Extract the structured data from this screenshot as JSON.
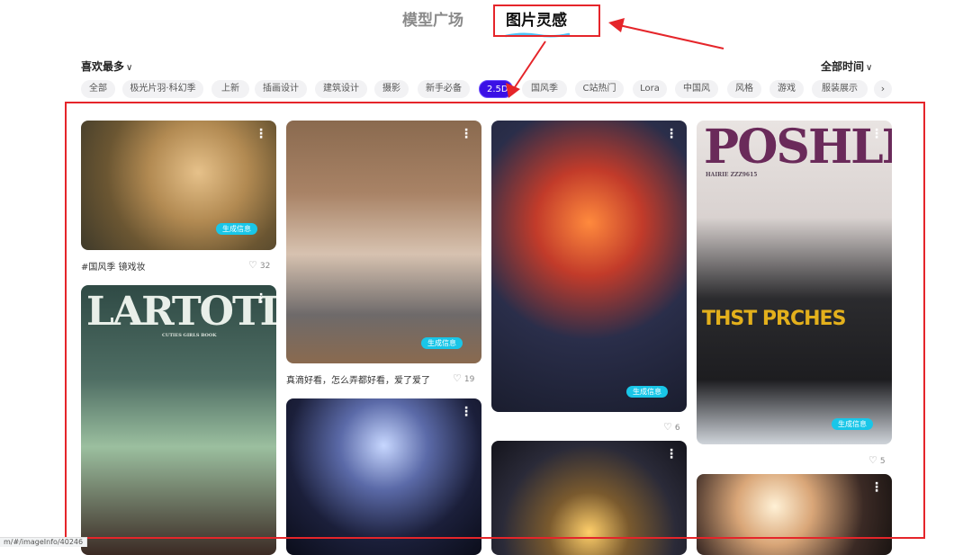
{
  "header": {
    "tabs": [
      {
        "label": "模型广场",
        "active": false
      },
      {
        "label": "图片灵感",
        "active": true
      }
    ]
  },
  "filters": {
    "sort_label": "喜欢最多",
    "time_label": "全部时间",
    "tags": [
      {
        "label": "全部",
        "active": false
      },
      {
        "label": "极光片羽·科幻季",
        "active": false
      },
      {
        "label": "上新",
        "active": false
      },
      {
        "label": "插画设计",
        "active": false
      },
      {
        "label": "建筑设计",
        "active": false
      },
      {
        "label": "摄影",
        "active": false
      },
      {
        "label": "新手必备",
        "active": false
      },
      {
        "label": "2.5D",
        "active": true
      },
      {
        "label": "国风季",
        "active": false
      },
      {
        "label": "C站热门",
        "active": false
      },
      {
        "label": "Lora",
        "active": false
      },
      {
        "label": "中国风",
        "active": false
      },
      {
        "label": "风格",
        "active": false
      },
      {
        "label": "游戏",
        "active": false
      },
      {
        "label": "服装展示",
        "active": false
      }
    ],
    "more_icon": "chevron-right-icon"
  },
  "cards": [
    {
      "badge": "生成信息",
      "caption": "#国风季 镜戏妆",
      "likes": "32"
    },
    {
      "badge": "",
      "caption": "",
      "likes": "",
      "magazine_title": "LARTOTIE",
      "magazine_sub": "CUTIES GIRLS BOOK"
    },
    {
      "badge": "生成信息",
      "caption": "真滴好看，怎么弄都好看，爱了爱了",
      "likes": "19"
    },
    {
      "badge": "",
      "caption": "",
      "likes": ""
    },
    {
      "badge": "生成信息",
      "caption": "",
      "likes": "6"
    },
    {
      "badge": "",
      "caption": "",
      "likes": ""
    },
    {
      "badge": "生成信息",
      "caption": "",
      "likes": "5",
      "magazine_title": "POSHLD",
      "magazine_sub": "HAIRIE ZZZ9615",
      "magazine_side": "THST PRCHES"
    },
    {
      "badge": "",
      "caption": "",
      "likes": ""
    }
  ],
  "status_bar": {
    "url": "m/#/imageInfo/40246"
  },
  "colors": {
    "accent": "#3a10e5",
    "badge": "#19c6e8",
    "highlight": "#e5252a"
  }
}
